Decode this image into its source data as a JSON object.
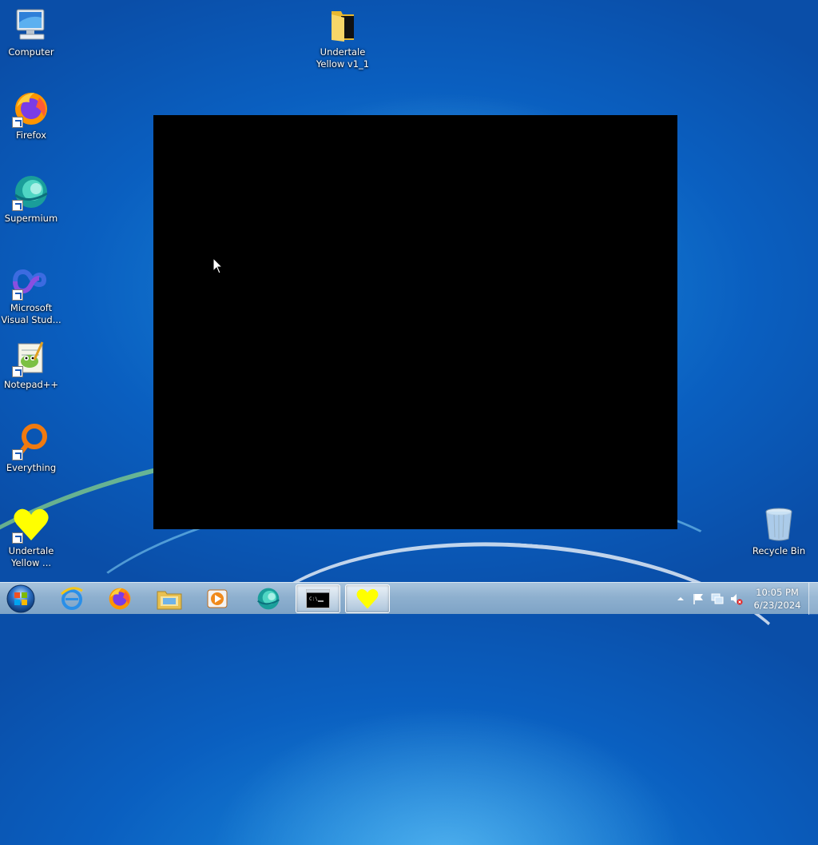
{
  "desktop": {
    "icons": [
      {
        "label": "Computer"
      },
      {
        "label": "Firefox"
      },
      {
        "label": "Supermium"
      },
      {
        "label": "Microsoft Visual Stud..."
      },
      {
        "label": "Notepad++"
      },
      {
        "label": "Everything"
      },
      {
        "label": "Undertale Yellow ..."
      },
      {
        "label": "Undertale Yellow v1_1"
      },
      {
        "label": "Recycle Bin"
      }
    ]
  },
  "taskbar": {
    "start": {
      "icon": "windows-start-orb-icon"
    },
    "pinned": [
      {
        "icon": "internet-explorer-icon"
      },
      {
        "icon": "firefox-icon"
      },
      {
        "icon": "file-explorer-icon"
      },
      {
        "icon": "media-player-icon"
      },
      {
        "icon": "supermium-icon"
      },
      {
        "icon": "command-prompt-icon"
      },
      {
        "icon": "undertale-yellow-heart-icon"
      }
    ],
    "tray": {
      "icons": [
        "show-hidden-icons-arrow-icon",
        "action-center-flag-icon",
        "network-icon",
        "volume-muted-icon"
      ],
      "time": "10:05 PM",
      "date": "6/23/2024"
    }
  },
  "colors": {
    "heart_yellow": "#ffff00",
    "game_window_bg": "#000000"
  }
}
